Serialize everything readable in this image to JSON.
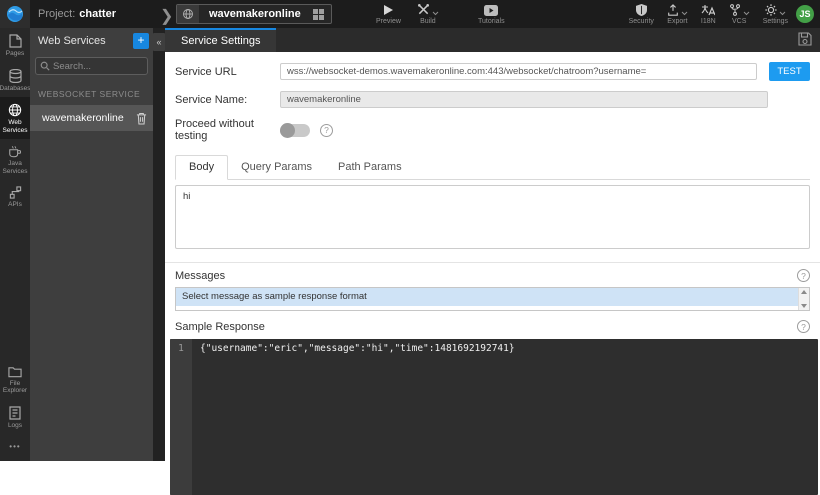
{
  "glyphs": {
    "plus": "+",
    "collapse": "«",
    "more": "•••",
    "help": "?",
    "breadcrumb_chevron": "❯"
  },
  "top_bar": {
    "project_prefix": "Project:",
    "project_name": "chatter",
    "service_tab_label": "wavemakeronline",
    "preview_label": "Preview",
    "build_label": "Build",
    "tutorials_label": "Tutorials",
    "security_label": "Security",
    "export_label": "Export",
    "i18n_label": "I18N",
    "vcs_label": "VCS",
    "settings_label": "Settings",
    "avatar_initials": "JS"
  },
  "sidebar": {
    "items": [
      {
        "label": "Pages"
      },
      {
        "label": "Databases"
      },
      {
        "label": "Web Services"
      },
      {
        "label": "Java Services"
      },
      {
        "label": "APIs"
      }
    ],
    "bottom_items": [
      {
        "label": "File Explorer"
      },
      {
        "label": "Logs"
      }
    ]
  },
  "panel": {
    "title": "Web Services",
    "search_placeholder": "Search...",
    "section_label": "WEBSOCKET SERVICE",
    "service_name": "wavemakeronline"
  },
  "settings": {
    "tab_label": "Service Settings",
    "service_url_label": "Service URL",
    "service_url_value": "wss://websocket-demos.wavemakeronline.com:443/websocket/chatroom?username=",
    "test_button": "TEST",
    "service_name_label": "Service Name:",
    "service_name_value": "wavemakeronline",
    "proceed_label": "Proceed without testing",
    "request_tabs": [
      {
        "label": "Body"
      },
      {
        "label": "Query Params"
      },
      {
        "label": "Path Params"
      }
    ],
    "body_value": "hi",
    "messages_label": "Messages",
    "message_option": "Select message as sample response format",
    "sample_response_label": "Sample Response",
    "code_line_number": "1",
    "code_line": "{\"username\":\"eric\",\"message\":\"hi\",\"time\":1481692192741}"
  },
  "colors": {
    "accent_blue": "#1787e0",
    "test_button_blue": "#1d9bf0",
    "selected_message_bg": "#cfe3f6",
    "avatar_green": "#43a047"
  }
}
